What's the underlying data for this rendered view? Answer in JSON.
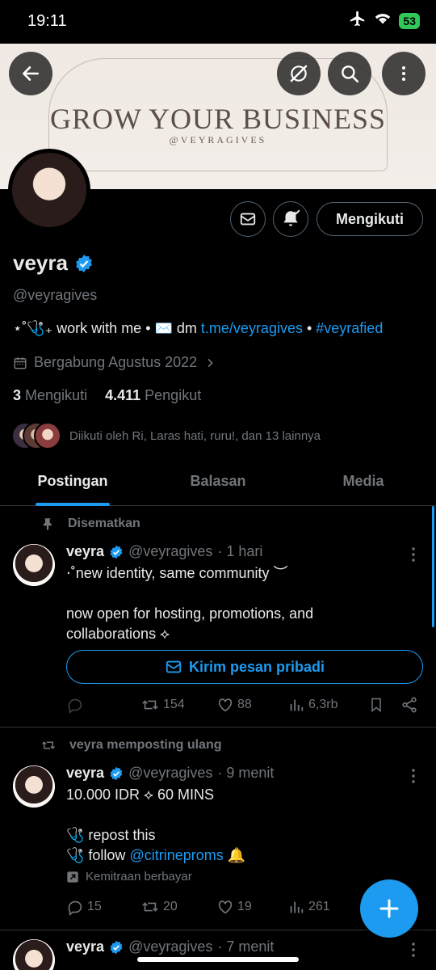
{
  "status_bar": {
    "time": "19:11",
    "battery": "53"
  },
  "banner": {
    "title": "GROW YOUR BUSINESS",
    "subtitle": "@VEYRAGIVES"
  },
  "profile": {
    "name": "veyra",
    "handle": "@veyragives",
    "bio_prefix": "⋆˚🩺₊ work with me • ✉️ dm ",
    "bio_link": "t.me/veyragives",
    "bio_sep": " • ",
    "bio_hashtag": "#veyrafied",
    "joined": "Bergabung Agustus 2022",
    "following_count": "3",
    "following_label": "Mengikuti",
    "followers_count": "4.411",
    "followers_label": "Pengikut",
    "followed_by": "Diikuti oleh Ri, Laras hati, ruru!, dan 13 lainnya",
    "follow_button": "Mengikuti"
  },
  "tabs": [
    {
      "label": "Postingan",
      "active": true
    },
    {
      "label": "Balasan",
      "active": false
    },
    {
      "label": "Media",
      "active": false
    }
  ],
  "posts": [
    {
      "context": "Disematkan",
      "name": "veyra",
      "handle": "@veyragives",
      "time": "· 1 hari",
      "line1": "⋅˚new identity, same community ︶",
      "line2": "now open for hosting, promotions, and",
      "line3": "collaborations ⟡",
      "dm_button": "Kirim pesan pribadi",
      "replies": "",
      "reposts": "154",
      "likes": "88",
      "views": "6,3rb"
    },
    {
      "context": "veyra memposting ulang",
      "name": "veyra",
      "handle": "@veyragives",
      "time": "· 9 menit",
      "line1": "10.000 IDR ⟡ 60 MINS",
      "line2": "🩺 repost this",
      "line3_prefix": "🩺 follow ",
      "line3_mention": "@citrineproms",
      "line3_suffix": " 🔔",
      "paid_label": "Kemitraan berbayar",
      "replies": "15",
      "reposts": "20",
      "likes": "19",
      "views": "261"
    },
    {
      "name": "veyra",
      "handle": "@veyragives",
      "time": "· 7 menit"
    }
  ],
  "colors": {
    "accent": "#1d9bf0",
    "muted": "#71767b",
    "text": "#e7e9ea",
    "border": "#2f3336"
  }
}
